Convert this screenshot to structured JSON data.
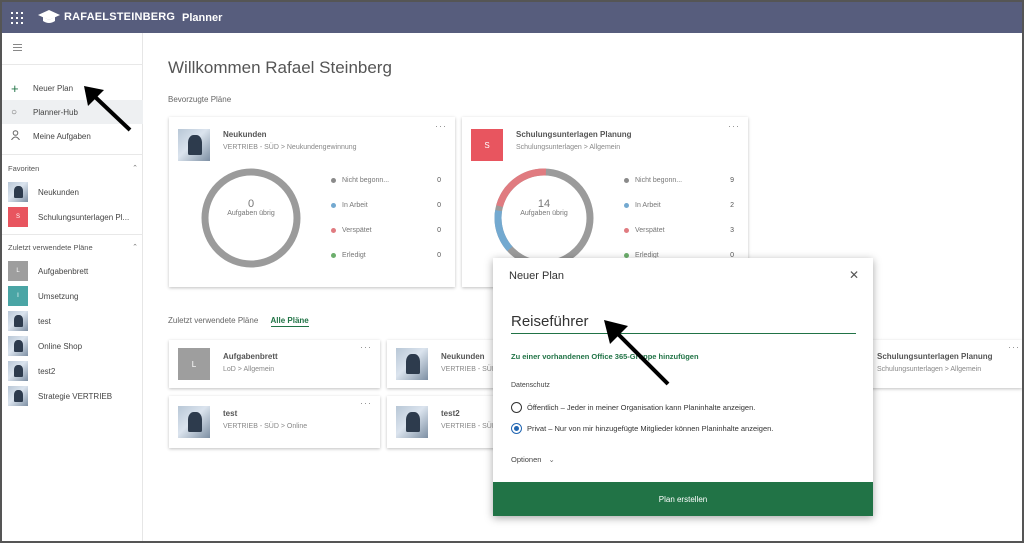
{
  "brand": {
    "name": "RAFAELSTEINBERG",
    "app": "Planner"
  },
  "nav": [
    {
      "label": "Neuer Plan",
      "icon": "plus-icon"
    },
    {
      "label": "Planner-Hub",
      "icon": "circle-icon"
    },
    {
      "label": "Meine Aufgaben",
      "icon": "person-icon"
    }
  ],
  "favorites": {
    "title": "Favoriten",
    "items": [
      {
        "label": "Neukunden"
      },
      {
        "label": "Schulungsunterlagen Pl...",
        "initial": "S",
        "color": "#e8555f"
      }
    ]
  },
  "recent_sidebar": {
    "title": "Zuletzt verwendete Pläne",
    "items": [
      {
        "label": "Aufgabenbrett",
        "initial": "L",
        "color": "#9e9e9e"
      },
      {
        "label": "Umsetzung",
        "initial": "I",
        "color": "#4aa5a5"
      },
      {
        "label": "test"
      },
      {
        "label": "Online Shop"
      },
      {
        "label": "test2"
      },
      {
        "label": "Strategie VERTRIEB"
      }
    ]
  },
  "main": {
    "welcome": "Willkommen Rafael Steinberg",
    "favorites_heading": "Bevorzugte Pläne",
    "legend_labels": [
      "Nicht begonn...",
      "In Arbeit",
      "Verspätet",
      "Erledigt"
    ],
    "remaining_label": "Aufgaben übrig",
    "recent_heading": "Zuletzt verwendete Pläne",
    "all_plans": "Alle Pläne"
  },
  "fav_cards": [
    {
      "title": "Neukunden",
      "group": "VERTRIEB - SÜD",
      "bucket": "Neukundengewinnung",
      "remaining": "0",
      "counts": [
        "0",
        "0",
        "0",
        "0"
      ]
    },
    {
      "title": "Schulungsunterlagen Planung",
      "group": "Schulungsunterlagen",
      "bucket": "Allgemein",
      "remaining": "14",
      "counts": [
        "9",
        "2",
        "3",
        "0"
      ],
      "initial": "S"
    }
  ],
  "recent_cards": [
    {
      "title": "Aufgabenbrett",
      "group": "LoD",
      "bucket": "Allgemein",
      "initial": "L"
    },
    {
      "title": "Neukunden",
      "group": "VERTRIEB - SÜD",
      "bucket": ""
    },
    {
      "title": "Schulungsunterlagen Planung",
      "group": "Schulungsunterlagen",
      "bucket": "Allgemein"
    },
    {
      "title": "test",
      "group": "VERTRIEB - SÜD",
      "bucket": "Online"
    },
    {
      "title": "test2",
      "group": "VERTRIEB - SÜD",
      "bucket": ""
    }
  ],
  "colors": {
    "accent": "#217346",
    "header": "#575d7d",
    "not_started": "#8a8a8a",
    "in_progress": "#73a9d0",
    "late": "#e07b80",
    "done": "#6cae6c"
  },
  "modal": {
    "title": "Neuer Plan",
    "name_value": "Reiseführer",
    "add_group": "Zu einer vorhandenen Office 365-Gruppe hinzufügen",
    "privacy_label": "Datenschutz",
    "public_option": "Öffentlich – Jeder in meiner Organisation kann Planinhalte anzeigen.",
    "private_option": "Privat – Nur von mir hinzugefügte Mitglieder können Planinhalte anzeigen.",
    "private_selected": true,
    "options_label": "Optionen",
    "create_button": "Plan erstellen"
  }
}
